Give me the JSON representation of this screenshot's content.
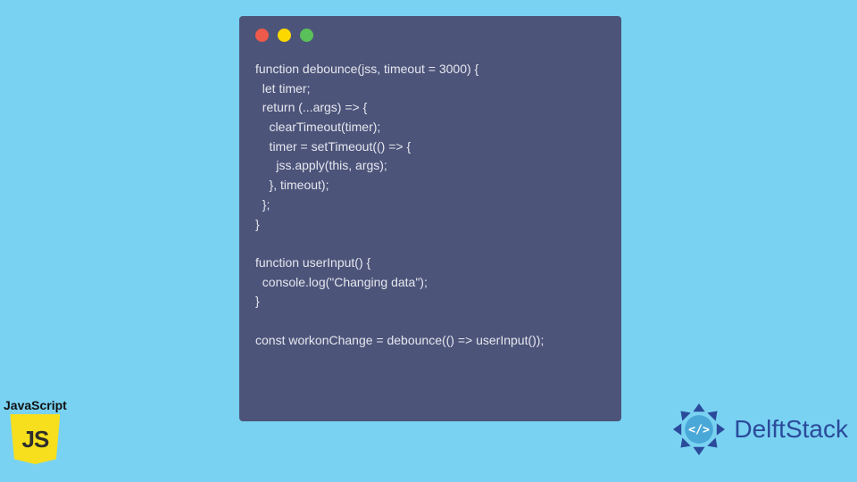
{
  "code": {
    "lines": [
      "function debounce(jss, timeout = 3000) {",
      "  let timer;",
      "  return (...args) => {",
      "    clearTimeout(timer);",
      "    timer = setTimeout(() => {",
      "      jss.apply(this, args);",
      "    }, timeout);",
      "  };",
      "}",
      "",
      "function userInput() {",
      "  console.log(\"Changing data\");",
      "}",
      "",
      "const workonChange = debounce(() => userInput());"
    ]
  },
  "js_badge": {
    "label": "JavaScript",
    "text": "JS"
  },
  "delftstack": {
    "brand": "DelftStack"
  },
  "traffic_lights": {
    "red": "#ed594a",
    "yellow": "#fdd800",
    "green": "#5ac05a"
  }
}
